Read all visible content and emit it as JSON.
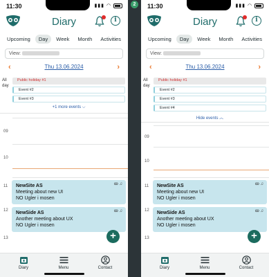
{
  "app": {
    "title": "Diary",
    "status_time": "11:30",
    "screen_badge": "2"
  },
  "tabs": [
    "Upcoming",
    "Day",
    "Week",
    "Month",
    "Activities"
  ],
  "active_tab": "Day",
  "view": {
    "label": "View:"
  },
  "date_nav": {
    "date": "Thu 13.06.2024",
    "prev": "‹",
    "next": "›"
  },
  "all_day": {
    "label": "All day"
  },
  "left": {
    "events": [
      {
        "title": "Public holiday #1",
        "kind": "holiday"
      },
      {
        "title": "Event #2",
        "kind": "normal"
      },
      {
        "title": "Event #3",
        "kind": "normal"
      }
    ],
    "toggle": "+1 more events ⌵"
  },
  "right": {
    "events": [
      {
        "title": "Public holiday #1",
        "kind": "holiday"
      },
      {
        "title": "Event #2",
        "kind": "normal"
      },
      {
        "title": "Event #3",
        "kind": "normal"
      },
      {
        "title": "Event #4",
        "kind": "normal"
      }
    ],
    "toggle": "Hide events ︿"
  },
  "hours": [
    "09",
    "10",
    "11",
    "12",
    "13"
  ],
  "meetings": [
    {
      "company": "NewSite AS",
      "desc": "Meeting about new UI",
      "location": "NO Ugler i mosen"
    },
    {
      "company": "NewSide AS",
      "desc": "Another meeting about UX",
      "location": "NO Ugler i mosen"
    }
  ],
  "bottom_nav": [
    {
      "label": "Diary",
      "icon": "calendar-icon"
    },
    {
      "label": "Menu",
      "icon": "hamburger-icon"
    },
    {
      "label": "Contact",
      "icon": "user-circle-icon"
    }
  ],
  "colors": {
    "brand": "#1f6c6a",
    "accent": "#e9782e",
    "link": "#2a5da8",
    "event_card": "#c7e5ed",
    "holiday_text": "#d03030",
    "fab": "#1b6b5e"
  }
}
